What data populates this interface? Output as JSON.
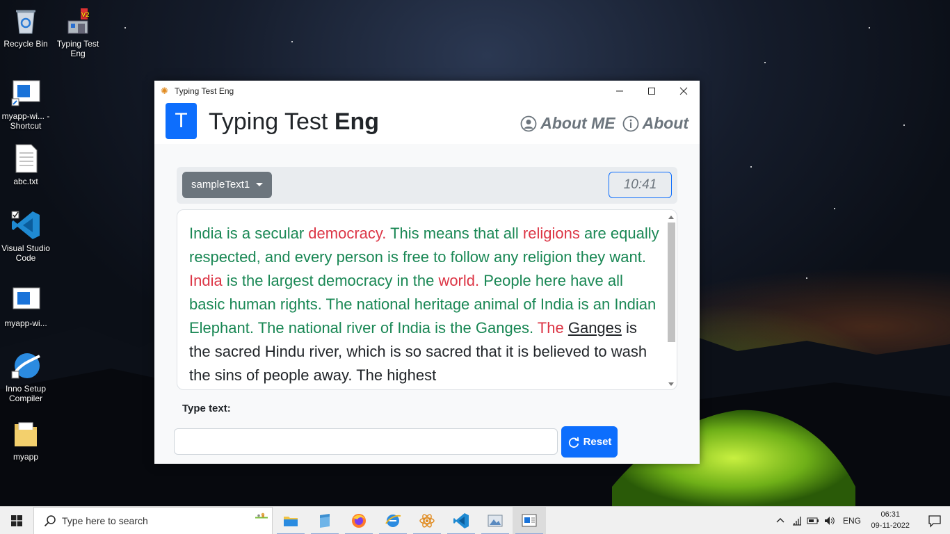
{
  "desktop": {
    "icons": [
      {
        "label": "Recycle Bin"
      },
      {
        "label": "Typing Test Eng"
      },
      {
        "label": "myapp-wi... - Shortcut"
      },
      {
        "label": "abc.txt"
      },
      {
        "label": "Visual Studio Code"
      },
      {
        "label": "myapp-wi..."
      },
      {
        "label": "Inno Setup Compiler"
      },
      {
        "label": "myapp"
      }
    ]
  },
  "window": {
    "title": "Typing Test Eng",
    "controls": {
      "minimize": "–",
      "maximize": "☐",
      "close": "✕"
    }
  },
  "header": {
    "logo_letter": "T",
    "brand_part1": "Typing Test",
    "brand_part2": "Eng",
    "nav": [
      {
        "label": "About ME",
        "icon": "user-circle-icon"
      },
      {
        "label": "About",
        "icon": "info-circle-icon"
      }
    ]
  },
  "toolbar": {
    "sample_select": "sampleText1",
    "timer": "10:41"
  },
  "passage": {
    "words": [
      {
        "t": "India",
        "s": "ok"
      },
      {
        "t": "is",
        "s": "ok"
      },
      {
        "t": "a",
        "s": "ok"
      },
      {
        "t": "secular",
        "s": "ok"
      },
      {
        "t": "democracy.",
        "s": "bad"
      },
      {
        "t": "This",
        "s": "ok"
      },
      {
        "t": "means",
        "s": "ok"
      },
      {
        "t": "that",
        "s": "ok"
      },
      {
        "t": "all",
        "s": "ok"
      },
      {
        "t": "religions",
        "s": "bad"
      },
      {
        "t": "are",
        "s": "ok"
      },
      {
        "t": "equally",
        "s": "ok"
      },
      {
        "t": "respected,",
        "s": "ok"
      },
      {
        "t": "and",
        "s": "ok"
      },
      {
        "t": "every",
        "s": "ok"
      },
      {
        "t": "person",
        "s": "ok"
      },
      {
        "t": "is",
        "s": "ok"
      },
      {
        "t": "free",
        "s": "ok"
      },
      {
        "t": "to",
        "s": "ok"
      },
      {
        "t": "follow",
        "s": "ok"
      },
      {
        "t": "any",
        "s": "ok"
      },
      {
        "t": "religion",
        "s": "ok"
      },
      {
        "t": "they",
        "s": "ok"
      },
      {
        "t": "want.",
        "s": "ok"
      },
      {
        "t": "India",
        "s": "bad"
      },
      {
        "t": "is",
        "s": "ok"
      },
      {
        "t": "the",
        "s": "ok"
      },
      {
        "t": "largest",
        "s": "ok"
      },
      {
        "t": "democracy",
        "s": "ok"
      },
      {
        "t": "in",
        "s": "ok"
      },
      {
        "t": "the",
        "s": "ok"
      },
      {
        "t": "world.",
        "s": "bad"
      },
      {
        "t": "People",
        "s": "ok"
      },
      {
        "t": "here",
        "s": "ok"
      },
      {
        "t": "have",
        "s": "ok"
      },
      {
        "t": "all",
        "s": "ok"
      },
      {
        "t": "basic",
        "s": "ok"
      },
      {
        "t": "human",
        "s": "ok"
      },
      {
        "t": "rights.",
        "s": "ok"
      },
      {
        "t": "The",
        "s": "ok"
      },
      {
        "t": "national",
        "s": "ok"
      },
      {
        "t": "heritage",
        "s": "ok"
      },
      {
        "t": "animal",
        "s": "ok"
      },
      {
        "t": "of",
        "s": "ok"
      },
      {
        "t": "India",
        "s": "ok"
      },
      {
        "t": "is",
        "s": "ok"
      },
      {
        "t": "an",
        "s": "ok"
      },
      {
        "t": "Indian",
        "s": "ok"
      },
      {
        "t": "Elephant.",
        "s": "ok"
      },
      {
        "t": "The",
        "s": "ok"
      },
      {
        "t": "national",
        "s": "ok"
      },
      {
        "t": "river",
        "s": "ok"
      },
      {
        "t": "of",
        "s": "ok"
      },
      {
        "t": "India",
        "s": "ok"
      },
      {
        "t": "is",
        "s": "ok"
      },
      {
        "t": "the",
        "s": "ok"
      },
      {
        "t": "Ganges.",
        "s": "ok"
      },
      {
        "t": "The",
        "s": "bad"
      },
      {
        "t": "Ganges",
        "s": "cur"
      },
      {
        "t": "is",
        "s": ""
      },
      {
        "t": "the",
        "s": ""
      },
      {
        "t": "sacred",
        "s": ""
      },
      {
        "t": "Hindu",
        "s": ""
      },
      {
        "t": "river,",
        "s": ""
      },
      {
        "t": "which",
        "s": ""
      },
      {
        "t": "is",
        "s": ""
      },
      {
        "t": "so",
        "s": ""
      },
      {
        "t": "sacred",
        "s": ""
      },
      {
        "t": "that",
        "s": ""
      },
      {
        "t": "it",
        "s": ""
      },
      {
        "t": "is",
        "s": ""
      },
      {
        "t": "believed",
        "s": ""
      },
      {
        "t": "to",
        "s": ""
      },
      {
        "t": "wash",
        "s": ""
      },
      {
        "t": "the",
        "s": ""
      },
      {
        "t": "sins",
        "s": ""
      },
      {
        "t": "of",
        "s": ""
      },
      {
        "t": "people",
        "s": ""
      },
      {
        "t": "away.",
        "s": ""
      },
      {
        "t": "The",
        "s": ""
      },
      {
        "t": "highest",
        "s": ""
      }
    ]
  },
  "typing": {
    "label": "Type text:",
    "input_value": "",
    "reset_label": "Reset"
  },
  "colors": {
    "primary": "#0d6efd",
    "secondary": "#6c757d",
    "correct": "#198754",
    "wrong": "#dc3545"
  },
  "taskbar": {
    "search_placeholder": "Type here to search",
    "apps": [
      "file-explorer-icon",
      "notepad-icon",
      "firefox-icon",
      "ie-icon",
      "react-icon",
      "vscode-icon",
      "image-viewer-icon",
      "app-window-icon"
    ],
    "tray_lang": "ENG",
    "time": "06:31",
    "date": "09-11-2022"
  }
}
